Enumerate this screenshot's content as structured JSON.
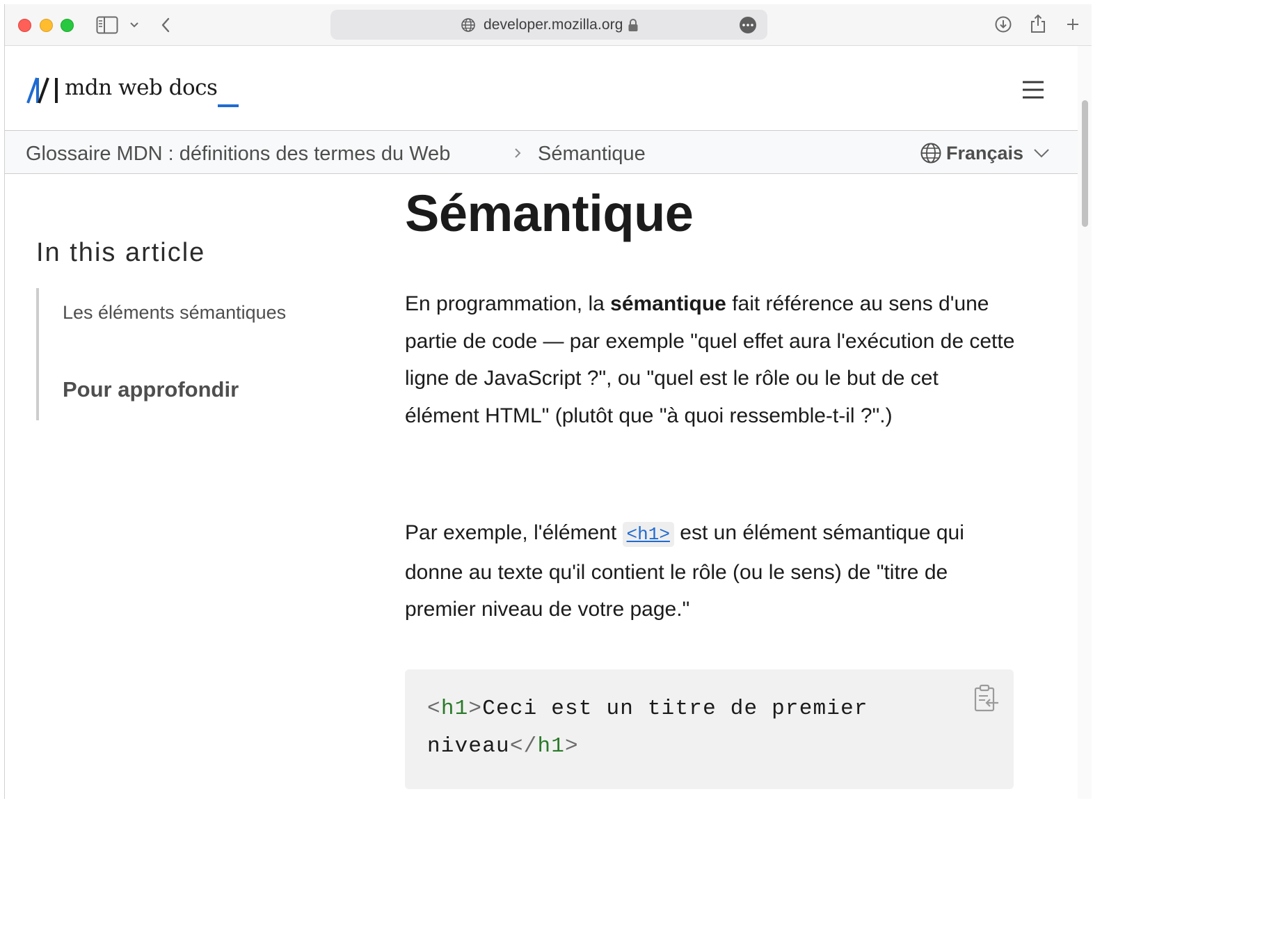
{
  "browser": {
    "address": "developer.mozilla.org"
  },
  "header": {
    "logo_text": "mdn web docs",
    "logo_cursor": "_"
  },
  "breadcrumb": {
    "items": [
      "Glossaire MDN : définitions des termes du Web",
      "Sémantique"
    ],
    "separator_icon": "chevron-right-icon"
  },
  "language": {
    "selected": "Français"
  },
  "toc": {
    "title": "In this article",
    "items": [
      "Les éléments sémantiques",
      "Pour approfondir"
    ]
  },
  "article": {
    "title": "Sémantique",
    "p1": {
      "before": "En programmation, la ",
      "bold": "sémantique",
      "after": " fait référence au sens d'une partie de code — par exemple \"quel effet aura l'exécution de cette ligne de JavaScript ?\", ou \"quel est le rôle ou le but de cet élément HTML\" (plutôt que \"à quoi ressemble-t-il ?\".)"
    },
    "p2": {
      "before": "Par exemple, l'élément ",
      "code": "<h1>",
      "after": " est un élément sémantique qui donne au texte qu'il contient le rôle (ou le sens) de \"titre de premier niveau de votre page.\""
    },
    "code_block": {
      "open_lt": "<",
      "open_tag": "h1",
      "open_gt": ">",
      "text_line1": "Ceci est un titre de premier",
      "text_line2": "niveau",
      "close_lt": "</",
      "close_tag": "h1",
      "close_gt": ">"
    }
  },
  "colors": {
    "accent": "#1f6bd1",
    "code_tag": "#2a7a2a",
    "code_bg": "#f2f1f1"
  }
}
